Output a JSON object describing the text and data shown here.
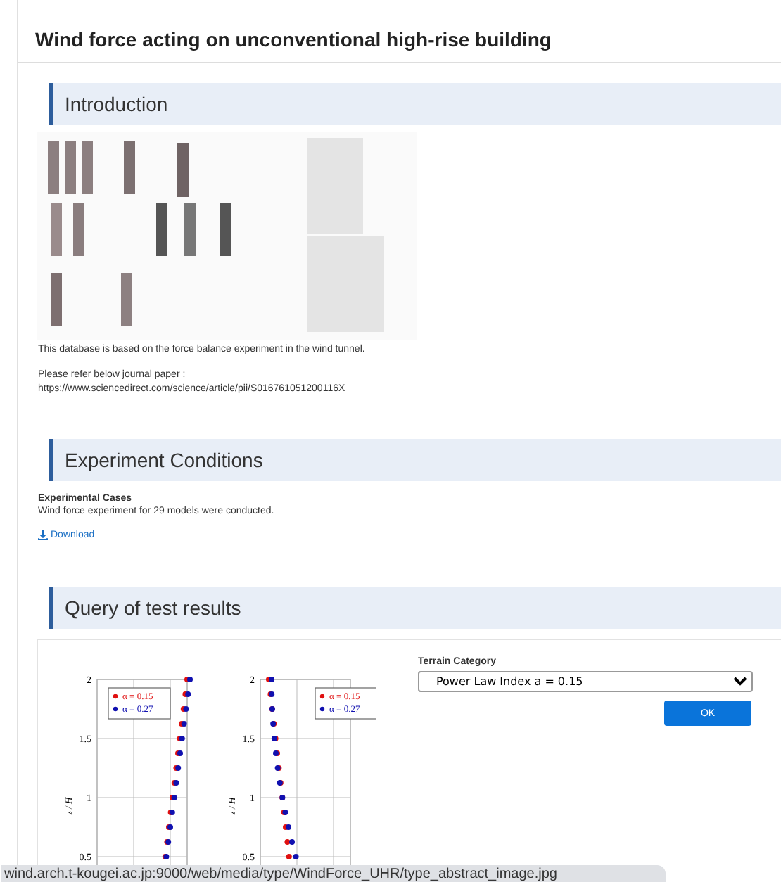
{
  "page_title": "Wind force acting on unconventional high-rise building",
  "introduction": {
    "heading": "Introduction",
    "description": "This database is based on the force balance experiment in the wind tunnel.",
    "reference_label": "Please refer below journal paper :",
    "reference_url": "https://www.sciencedirect.com/science/article/pii/S016761051200116X"
  },
  "experiment_conditions": {
    "heading": "Experiment Conditions",
    "subheading": "Experimental Cases",
    "text": "Wind force experiment for 29 models were conducted.",
    "download_link": "Download"
  },
  "query": {
    "heading": "Query of test results",
    "figures": [
      {
        "ylabel": "z / H",
        "yticks": [
          "2",
          "1.5",
          "1",
          "0.5"
        ],
        "legend": [
          {
            "label": "α = 0.15",
            "color": "#e01010"
          },
          {
            "label": "α = 0.27",
            "color": "#1010b0"
          }
        ]
      },
      {
        "ylabel": "z / H",
        "yticks": [
          "2",
          "1.5",
          "1",
          "0.5"
        ],
        "legend": [
          {
            "label": "α = 0.15",
            "color": "#e01010"
          },
          {
            "label": "α = 0.27",
            "color": "#1010b0"
          }
        ]
      }
    ],
    "terrain_label": "Terrain Category",
    "terrain_select": "Power Law Index a = 0.15",
    "ok_button": "OK"
  },
  "status_url": "wind.arch.t-kougei.ac.jp:9000/web/media/type/WindForce_UHR/type_abstract_image.jpg"
}
